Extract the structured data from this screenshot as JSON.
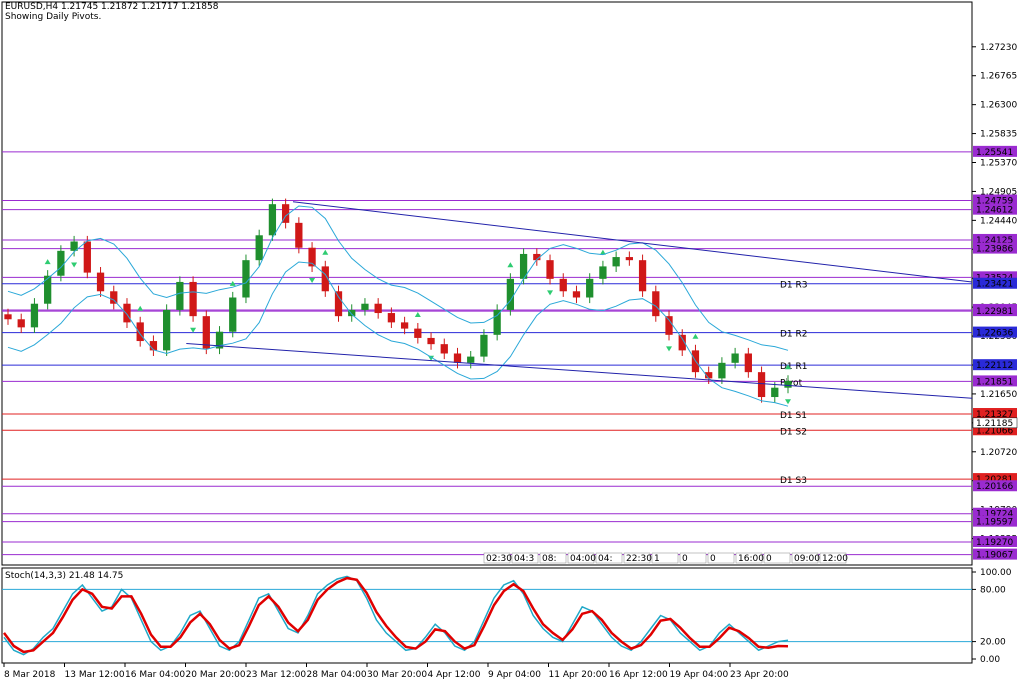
{
  "header": {
    "symbol_line": "EURUSD,H4  1.21745 1.21872 1.21717 1.21858",
    "subtitle": "Showing Daily Pivots."
  },
  "colors": {
    "up": "#1f8f2e",
    "down": "#d01818",
    "bands": "#2aa8d8",
    "pivot_purple": "#9a2bd0",
    "pivot_blue": "#2a2ad8",
    "support_red": "#e02020",
    "trendline": "#2222aa",
    "stoch_main": "#e00000",
    "stoch_signal": "#20a8c8",
    "fractal": "#2ecc71"
  },
  "chart_data": [
    {
      "type": "candlestick",
      "symbol": "EURUSD",
      "timeframe": "H4",
      "ohlc_last": {
        "open": 1.21745,
        "high": 1.21872,
        "low": 1.21717,
        "close": 1.21858
      },
      "ylim": [
        1.189,
        1.2795
      ],
      "y_ticks": [
        "1.27230",
        "1.26765",
        "1.26300",
        "1.25835",
        "1.25370",
        "1.24905",
        "1.24440",
        "1.23975",
        "1.23510",
        "1.23045",
        "1.22580",
        "1.22115",
        "1.21650",
        "1.21185",
        "1.20720",
        "1.20255",
        "1.19790",
        "1.19325",
        "1.18860"
      ],
      "x_ticks": [
        "8 Mar 2018",
        "13 Mar 12:00",
        "16 Mar 04:00",
        "20 Mar 20:00",
        "23 Mar 12:00",
        "28 Mar 04:00",
        "30 Mar 20:00",
        "4 Apr 12:00",
        "9 Apr 04:00",
        "11 Apr 20:00",
        "16 Apr 12:00",
        "19 Apr 04:00",
        "23 Apr 20:00"
      ],
      "close_path": [
        1.2285,
        1.2272,
        1.231,
        1.2355,
        1.2395,
        1.241,
        1.236,
        1.233,
        1.231,
        1.228,
        1.225,
        1.2235,
        1.23,
        1.2345,
        1.229,
        1.2238,
        1.2265,
        1.232,
        1.238,
        1.242,
        1.247,
        1.244,
        1.24,
        1.237,
        1.233,
        1.229,
        1.23,
        1.231,
        1.2295,
        1.228,
        1.227,
        1.2255,
        1.2245,
        1.223,
        1.2215,
        1.2225,
        1.226,
        1.23,
        1.235,
        1.239,
        1.238,
        1.235,
        1.233,
        1.232,
        1.235,
        1.237,
        1.2385,
        1.238,
        1.233,
        1.229,
        1.226,
        1.2235,
        1.22,
        1.219,
        1.2215,
        1.223,
        1.22,
        1.216,
        1.2175,
        1.2186
      ],
      "pivot_lines": [
        {
          "value": 1.25541,
          "label": "1.25541",
          "color": "#9a2bd0",
          "text": ""
        },
        {
          "value": 1.24759,
          "label": "1.24759",
          "color": "#9a2bd0",
          "text": ""
        },
        {
          "value": 1.24612,
          "label": "1.24612",
          "color": "#9a2bd0",
          "text": ""
        },
        {
          "value": 1.24125,
          "label": "1.24125",
          "color": "#9a2bd0",
          "text": ""
        },
        {
          "value": 1.23986,
          "label": "1.23986",
          "color": "#9a2bd0",
          "text": ""
        },
        {
          "value": 1.23524,
          "label": "1.23524",
          "color": "#9a2bd0",
          "text": ""
        },
        {
          "value": 1.23421,
          "label": "1.23421",
          "color": "#2a2ad8",
          "text": "D1 R3"
        },
        {
          "value": 1.23,
          "label": "1.23000",
          "color": "#9a2bd0",
          "text": ""
        },
        {
          "value": 1.22981,
          "label": "1.22981",
          "color": "#9a2bd0",
          "text": ""
        },
        {
          "value": 1.22636,
          "label": "1.22636",
          "color": "#2a2ad8",
          "text": "D1 R2"
        },
        {
          "value": 1.22112,
          "label": "1.22112",
          "color": "#2a2ad8",
          "text": "D1 R1"
        },
        {
          "value": 1.21851,
          "label": "1.21851",
          "color": "#9a2bd0",
          "text": "Pivot"
        },
        {
          "value": 1.21327,
          "label": "1.21327",
          "color": "#e02020",
          "text": "D1 S1"
        },
        {
          "value": 1.21066,
          "label": "1.21066",
          "color": "#e02020",
          "text": "D1 S2"
        },
        {
          "value": 1.20281,
          "label": "1.20281",
          "color": "#e02020",
          "text": "D1 S3"
        },
        {
          "value": 1.20166,
          "label": "1.20166",
          "color": "#9a2bd0",
          "text": ""
        },
        {
          "value": 1.19724,
          "label": "1.19724",
          "color": "#9a2bd0",
          "text": ""
        },
        {
          "value": 1.19597,
          "label": "1.19597",
          "color": "#9a2bd0",
          "text": ""
        },
        {
          "value": 1.1927,
          "label": "1.19270",
          "color": "#9a2bd0",
          "text": ""
        },
        {
          "value": 1.19067,
          "label": "1.19067",
          "color": "#9a2bd0",
          "text": ""
        }
      ],
      "price_tag": "1.21185",
      "trendlines": [
        {
          "from": [
            0.3,
            1.2474
          ],
          "to": [
            1.0,
            1.2345
          ]
        },
        {
          "from": [
            0.19,
            1.2246
          ],
          "to": [
            1.0,
            1.2158
          ]
        }
      ],
      "session_labels": [
        "02:30",
        "04:3",
        "08:",
        "04:00",
        "04:",
        "22:30",
        "1",
        "0",
        "0",
        "16:00",
        "0",
        "09:00",
        "12:00"
      ]
    },
    {
      "type": "line",
      "title": "Stoch(14,3,3) 21.48 14.75",
      "ylim": [
        0,
        100
      ],
      "y_ticks": [
        "100.00",
        "80.00",
        "20.00",
        "0.00"
      ],
      "levels": [
        80,
        20
      ],
      "series": [
        {
          "values": [
            25,
            10,
            5,
            12,
            25,
            35,
            55,
            75,
            85,
            70,
            55,
            60,
            80,
            70,
            45,
            20,
            10,
            15,
            30,
            50,
            55,
            35,
            15,
            10,
            20,
            45,
            70,
            75,
            55,
            35,
            30,
            50,
            75,
            85,
            92,
            95,
            90,
            70,
            45,
            30,
            20,
            10,
            12,
            25,
            40,
            30,
            15,
            10,
            20,
            45,
            70,
            85,
            90,
            75,
            50,
            35,
            25,
            20,
            40,
            60,
            55,
            40,
            25,
            15,
            10,
            20,
            35,
            50,
            45,
            30,
            20,
            10,
            15,
            30,
            40,
            30,
            20,
            10,
            15,
            20,
            21.48
          ]
        },
        {
          "values": [
            30,
            15,
            8,
            10,
            20,
            30,
            48,
            68,
            80,
            75,
            60,
            58,
            72,
            72,
            52,
            28,
            14,
            14,
            25,
            42,
            52,
            40,
            22,
            12,
            16,
            38,
            62,
            72,
            60,
            42,
            32,
            45,
            68,
            80,
            88,
            93,
            91,
            76,
            54,
            38,
            25,
            14,
            12,
            20,
            34,
            32,
            20,
            12,
            16,
            38,
            62,
            78,
            86,
            78,
            58,
            40,
            30,
            22,
            34,
            52,
            55,
            45,
            30,
            20,
            12,
            16,
            28,
            44,
            46,
            36,
            24,
            14,
            14,
            24,
            36,
            32,
            24,
            14,
            13,
            15,
            14.75
          ]
        }
      ]
    }
  ]
}
